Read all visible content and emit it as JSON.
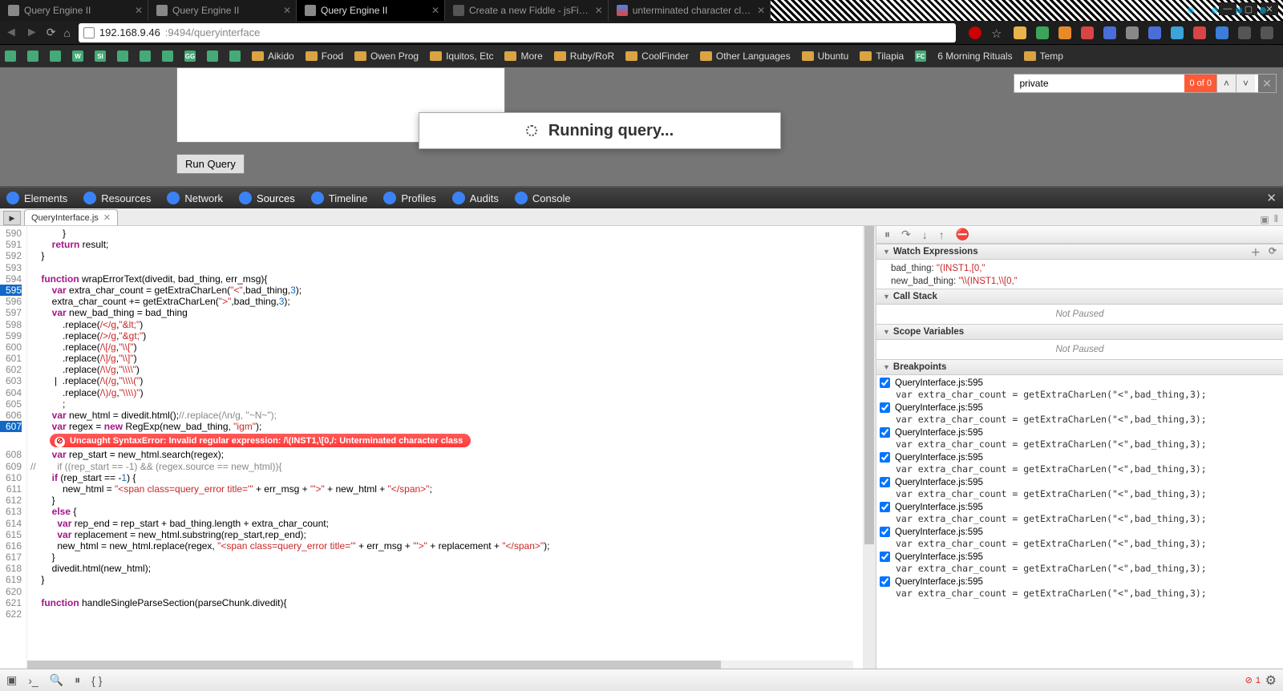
{
  "titlebar": {
    "tabs": [
      {
        "label": "Query Engine II",
        "active": false,
        "favclass": "favicon"
      },
      {
        "label": "Query Engine II",
        "active": false,
        "favclass": "favicon"
      },
      {
        "label": "Query Engine II",
        "active": true,
        "favclass": "favicon"
      },
      {
        "label": "Create a new Fiddle - jsFi…",
        "active": false,
        "favclass": "favicon fav-j"
      },
      {
        "label": "unterminated character cl…",
        "active": false,
        "favclass": "favicon fav-g"
      }
    ],
    "winctrls": {
      "min": "—",
      "max": "▢",
      "close": "✕"
    }
  },
  "navbar": {
    "url_host": "192.168.9.46",
    "url_port_path": ":9494/queryinterface"
  },
  "bookmarks": [
    {
      "type": "icon",
      "label": ""
    },
    {
      "type": "icon",
      "label": ""
    },
    {
      "type": "icon",
      "label": ""
    },
    {
      "type": "icon",
      "label": "W"
    },
    {
      "type": "icon",
      "label": "SI"
    },
    {
      "type": "icon",
      "label": ""
    },
    {
      "type": "icon",
      "label": ""
    },
    {
      "type": "icon",
      "label": ""
    },
    {
      "type": "icon",
      "label": "GG"
    },
    {
      "type": "icon",
      "label": ""
    },
    {
      "type": "icon",
      "label": ""
    },
    {
      "type": "folder",
      "label": "Aikido"
    },
    {
      "type": "folder",
      "label": "Food"
    },
    {
      "type": "folder",
      "label": "Owen Prog"
    },
    {
      "type": "folder",
      "label": "Iquitos, Etc"
    },
    {
      "type": "folder",
      "label": "More"
    },
    {
      "type": "folder",
      "label": "Ruby/RoR"
    },
    {
      "type": "folder",
      "label": "CoolFinder"
    },
    {
      "type": "folder",
      "label": "Other Languages"
    },
    {
      "type": "folder",
      "label": "Ubuntu"
    },
    {
      "type": "folder",
      "label": "Tilapia"
    },
    {
      "type": "icon",
      "label": "FC"
    },
    {
      "type": "plain",
      "label": "6 Morning Rituals"
    },
    {
      "type": "folder",
      "label": "Temp"
    }
  ],
  "page": {
    "run_btn": "Run Query",
    "modal_text": "Running query...",
    "find_value": "private",
    "find_count": "0 of 0"
  },
  "devtools": {
    "tabs": [
      "Elements",
      "Resources",
      "Network",
      "Sources",
      "Timeline",
      "Profiles",
      "Audits",
      "Console"
    ],
    "active_idx": 3,
    "file_tab": "QueryInterface.js",
    "error_bubble": "Uncaught SyntaxError: Invalid regular expression: /\\(INST1,\\[0,/: Unterminated character class",
    "lines": [
      {
        "n": 590,
        "c": "            }"
      },
      {
        "n": 591,
        "c": "        return result;",
        "tokens": [
          [
            "kw",
            "return"
          ],
          [
            "op",
            " result;"
          ]
        ]
      },
      {
        "n": 592,
        "c": "    }"
      },
      {
        "n": 593,
        "c": ""
      },
      {
        "n": 594,
        "c": "    function wrapErrorText(divedit, bad_thing, err_msg){",
        "tokens": [
          [
            "kw",
            "function"
          ],
          [
            "op",
            " wrapErrorText(divedit, bad_thing, err_msg){"
          ]
        ]
      },
      {
        "n": 595,
        "hl": true,
        "c": "        var extra_char_count = getExtraCharLen(\"<\",bad_thing,3);",
        "tokens": [
          [
            "kw",
            "var"
          ],
          [
            "op",
            " extra_char_count = getExtraCharLen("
          ],
          [
            "str",
            "\"<\""
          ],
          [
            "op",
            ",bad_thing,"
          ],
          [
            "num",
            "3"
          ],
          [
            "op",
            ");"
          ]
        ]
      },
      {
        "n": 596,
        "c": "        extra_char_count += getExtraCharLen(\">\",bad_thing,3);",
        "tokens": [
          [
            "op",
            "        extra_char_count += getExtraCharLen("
          ],
          [
            "str",
            "\">\""
          ],
          [
            "op",
            ",bad_thing,"
          ],
          [
            "num",
            "3"
          ],
          [
            "op",
            ");"
          ]
        ]
      },
      {
        "n": 597,
        "c": "        var new_bad_thing = bad_thing",
        "tokens": [
          [
            "kw",
            "var"
          ],
          [
            "op",
            " new_bad_thing = bad_thing"
          ]
        ]
      },
      {
        "n": 598,
        "c": "            .replace(/</g,\"&lt;\")",
        "tokens": [
          [
            "op",
            "            .replace("
          ],
          [
            "str",
            "/</g"
          ],
          [
            "op",
            ","
          ],
          [
            "str",
            "\"&lt;\""
          ],
          [
            "op",
            ")"
          ]
        ]
      },
      {
        "n": 599,
        "c": "            .replace(/>/g,\"&gt;\")",
        "tokens": [
          [
            "op",
            "            .replace("
          ],
          [
            "str",
            "/>/g"
          ],
          [
            "op",
            ","
          ],
          [
            "str",
            "\"&gt;\""
          ],
          [
            "op",
            ")"
          ]
        ]
      },
      {
        "n": 600,
        "c": "            .replace(/\\[/g,\"\\\\[\")",
        "tokens": [
          [
            "op",
            "            .replace("
          ],
          [
            "str",
            "/\\[/g"
          ],
          [
            "op",
            ","
          ],
          [
            "str",
            "\"\\\\[\""
          ],
          [
            "op",
            ")"
          ]
        ]
      },
      {
        "n": 601,
        "c": "            .replace(/\\]/g,\"\\\\]\")",
        "tokens": [
          [
            "op",
            "            .replace("
          ],
          [
            "str",
            "/\\]/g"
          ],
          [
            "op",
            ","
          ],
          [
            "str",
            "\"\\\\]\""
          ],
          [
            "op",
            ")"
          ]
        ]
      },
      {
        "n": 602,
        "c": "            .replace(/\\\\/g,\"\\\\\\\\\")",
        "tokens": [
          [
            "op",
            "            .replace("
          ],
          [
            "str",
            "/\\\\/g"
          ],
          [
            "op",
            ","
          ],
          [
            "str",
            "\"\\\\\\\\\""
          ],
          [
            "op",
            ")"
          ]
        ]
      },
      {
        "n": 603,
        "c": "         |  .replace(/\\(/g,\"\\\\\\\\(\")",
        "tokens": [
          [
            "op",
            "         |  .replace("
          ],
          [
            "str",
            "/\\(/g"
          ],
          [
            "op",
            ","
          ],
          [
            "str",
            "\"\\\\\\\\(\""
          ],
          [
            "op",
            ")"
          ]
        ]
      },
      {
        "n": 604,
        "c": "            .replace(/\\)/g,\"\\\\\\\\)\")",
        "tokens": [
          [
            "op",
            "            .replace("
          ],
          [
            "str",
            "/\\)/g"
          ],
          [
            "op",
            ","
          ],
          [
            "str",
            "\"\\\\\\\\)\""
          ],
          [
            "op",
            ")"
          ]
        ]
      },
      {
        "n": 605,
        "c": "            ;"
      },
      {
        "n": 606,
        "c": "        var new_html = divedit.html();//.replace(/\\n/g, \"~N~\");",
        "tokens": [
          [
            "kw",
            "var"
          ],
          [
            "op",
            " new_html = divedit.html();"
          ],
          [
            "cmt",
            "//.replace(/\\n/g, \"~N~\");"
          ]
        ]
      },
      {
        "n": 607,
        "hl": true,
        "c": "        var regex = new RegExp(new_bad_thing, \"igm\");",
        "tokens": [
          [
            "kw",
            "var"
          ],
          [
            "op",
            " regex = "
          ],
          [
            "kw",
            "new"
          ],
          [
            "op",
            " RegExp(new_bad_thing, "
          ],
          [
            "str",
            "\"igm\""
          ],
          [
            "op",
            ");"
          ]
        ]
      },
      {
        "n": "err"
      },
      {
        "n": 608,
        "c": "        var rep_start = new_html.search(regex);",
        "tokens": [
          [
            "kw",
            "var"
          ],
          [
            "op",
            " rep_start = new_html.search(regex);"
          ]
        ]
      },
      {
        "n": 609,
        "c": "//        if ((rep_start == -1) && (regex.source == new_html)){",
        "tokens": [
          [
            "cmt",
            "//        if ((rep_start == -1) && (regex.source == new_html)){"
          ]
        ]
      },
      {
        "n": 610,
        "c": "        if (rep_start == -1) {",
        "tokens": [
          [
            "kw",
            "if"
          ],
          [
            "op",
            " (rep_start == -"
          ],
          [
            "num",
            "1"
          ],
          [
            "op",
            ") {"
          ]
        ]
      },
      {
        "n": 611,
        "c": "            new_html = \"<span class=query_error title='\" + err_msg + \"'>\" + new_html + \"</span>\";",
        "tokens": [
          [
            "op",
            "            new_html = "
          ],
          [
            "str",
            "\"<span class=query_error title='\""
          ],
          [
            "op",
            " + err_msg + "
          ],
          [
            "str",
            "\"'>\""
          ],
          [
            "op",
            " + new_html + "
          ],
          [
            "str",
            "\"</span>\""
          ],
          [
            "op",
            ";"
          ]
        ]
      },
      {
        "n": 612,
        "c": "        }"
      },
      {
        "n": 613,
        "c": "        else {",
        "tokens": [
          [
            "kw",
            "else"
          ],
          [
            "op",
            " {"
          ]
        ]
      },
      {
        "n": 614,
        "c": "          var rep_end = rep_start + bad_thing.length + extra_char_count;",
        "tokens": [
          [
            "kw",
            "var"
          ],
          [
            "op",
            " rep_end = rep_start + bad_thing.length + extra_char_count;"
          ]
        ]
      },
      {
        "n": 615,
        "c": "          var replacement = new_html.substring(rep_start,rep_end);",
        "tokens": [
          [
            "kw",
            "var"
          ],
          [
            "op",
            " replacement = new_html.substring(rep_start,rep_end);"
          ]
        ]
      },
      {
        "n": 616,
        "c": "          new_html = new_html.replace(regex, \"<span class=query_error title='\" + err_msg + \"'>\" + replacement + \"</span>\");",
        "tokens": [
          [
            "op",
            "          new_html = new_html.replace(regex, "
          ],
          [
            "str",
            "\"<span class=query_error title='\""
          ],
          [
            "op",
            " + err_msg + "
          ],
          [
            "str",
            "\"'>\""
          ],
          [
            "op",
            " + replacement + "
          ],
          [
            "str",
            "\"</span>\""
          ],
          [
            "op",
            ");"
          ]
        ]
      },
      {
        "n": 617,
        "c": "        }"
      },
      {
        "n": 618,
        "c": "        divedit.html(new_html);"
      },
      {
        "n": 619,
        "c": "    }"
      },
      {
        "n": 620,
        "c": ""
      },
      {
        "n": 621,
        "c": "    function handleSingleParseSection(parseChunk.divedit){",
        "tokens": [
          [
            "kw",
            "function"
          ],
          [
            "op",
            " handleSingleParseSection(parseChunk.divedit){"
          ]
        ]
      },
      {
        "n": 622,
        "c": ""
      }
    ]
  },
  "sidebar": {
    "watch_hdr": "Watch Expressions",
    "watches": [
      {
        "name": "bad_thing: ",
        "value": "\"(INST1,[0,\""
      },
      {
        "name": "new_bad_thing: ",
        "value": "\"\\\\(INST1,\\\\[0,\""
      }
    ],
    "callstack_hdr": "Call Stack",
    "scopevar_hdr": "Scope Variables",
    "notpaused": "Not Paused",
    "breakpoints_hdr": "Breakpoints",
    "bp_file": "QueryInterface.js:595",
    "bp_code": "var extra_char_count = getExtraCharLen(\"<\",bad_thing,3);",
    "bp_count": 9
  },
  "console": {
    "err_count": "1"
  }
}
